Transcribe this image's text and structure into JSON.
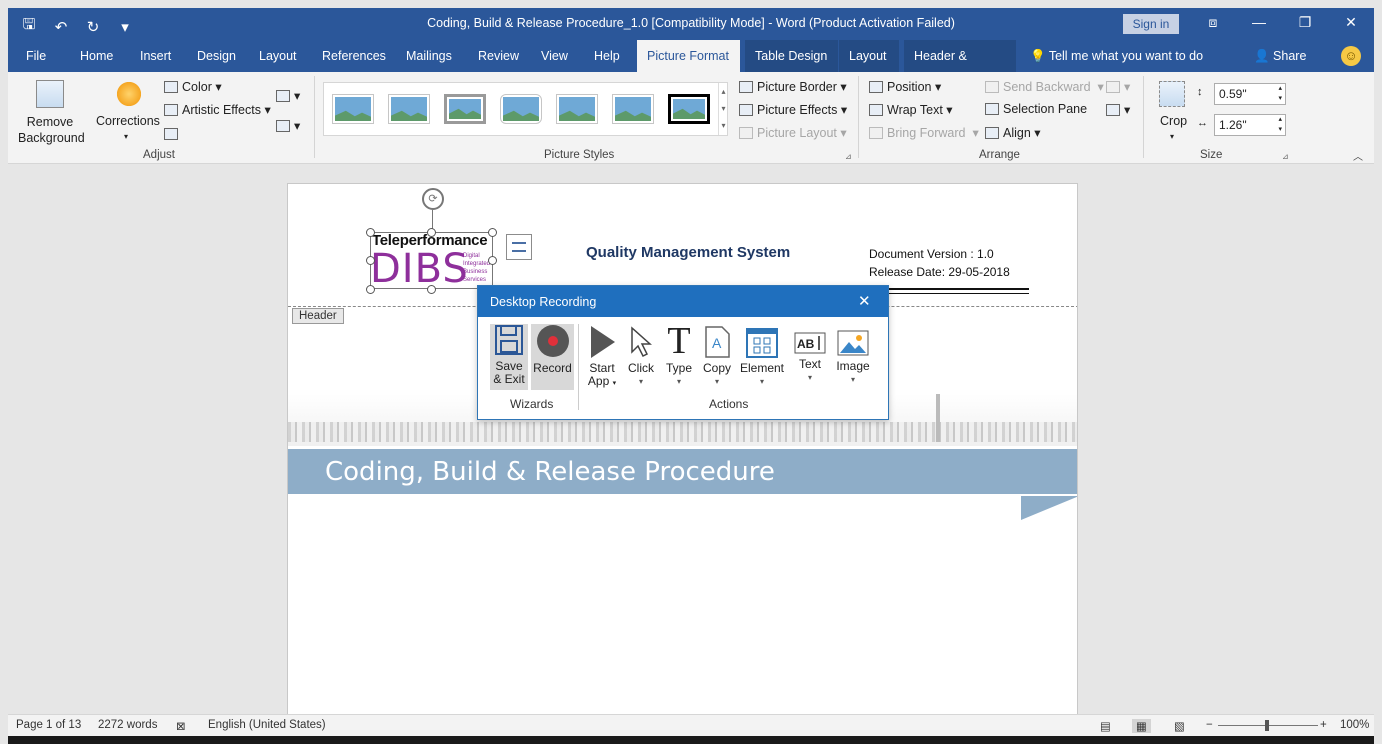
{
  "titlebar": {
    "title": "Coding, Build & Release Procedure_1.0 [Compatibility Mode]  -  Word (Product Activation Failed)",
    "sign_in": "Sign in",
    "qat": {
      "save": "🖫",
      "undo": "↶",
      "redo": "↻",
      "customize": "▾"
    },
    "window_buttons": {
      "ribbon_display": "⧈",
      "minimize": "—",
      "restore": "❐",
      "close": "✕"
    }
  },
  "tabs": [
    "File",
    "Home",
    "Insert",
    "Design",
    "Layout",
    "References",
    "Mailings",
    "Review",
    "View",
    "Help",
    "Picture Format",
    "Table Design",
    "Layout",
    "Header & Footer"
  ],
  "tell_me": "Tell me what you want to do",
  "share": "Share",
  "smiley": "☺",
  "ribbon": {
    "adjust": {
      "remove_background": "Remove Background",
      "remove_background_l1": "Remove",
      "remove_background_l2": "Background",
      "corrections": "Corrections",
      "color": "Color",
      "artistic_effects": "Artistic Effects",
      "group_label": "Adjust"
    },
    "picture_styles": {
      "picture_border": "Picture Border",
      "picture_effects": "Picture Effects",
      "picture_layout": "Picture Layout",
      "group_label": "Picture Styles"
    },
    "arrange": {
      "position": "Position",
      "wrap_text": "Wrap Text",
      "bring_forward": "Bring Forward",
      "send_backward": "Send Backward",
      "selection_pane": "Selection Pane",
      "align": "Align",
      "group_label": "Arrange"
    },
    "size": {
      "crop": "Crop",
      "height": "0.59\"",
      "width": "1.26\"",
      "group_label": "Size"
    }
  },
  "document": {
    "header_tag": "Header",
    "qms": "Quality Management System",
    "doc_version": "Document Version : 1.0",
    "release_date": "Release Date: 29-05-2018",
    "logo_brand": "Teleperformance",
    "logo_mark": "DIBS",
    "logo_sub": [
      "Digital",
      "Integrated",
      "Business",
      "Services"
    ],
    "banner_title": "Coding, Build & Release Procedure"
  },
  "recording_dialog": {
    "title": "Desktop Recording",
    "close": "✕",
    "wizards": [
      {
        "label1": "Save",
        "label2": "& Exit"
      },
      {
        "label1": "Record",
        "label2": ""
      }
    ],
    "wizards_label": "Wizards",
    "actions": [
      {
        "label1": "Start",
        "label2": "App"
      },
      {
        "label1": "Click",
        "label2": ""
      },
      {
        "label1": "Type",
        "label2": ""
      },
      {
        "label1": "Copy",
        "label2": ""
      },
      {
        "label1": "Element",
        "label2": ""
      },
      {
        "label1": "Text",
        "label2": ""
      },
      {
        "label1": "Image",
        "label2": ""
      }
    ],
    "actions_label": "Actions"
  },
  "status": {
    "page": "Page 1 of 13",
    "words": "2272 words",
    "language": "English (United States)",
    "zoom": "100%"
  },
  "colors": {
    "word_blue": "#2b579a",
    "dialog_blue": "#1f6fbe",
    "logo_purple": "#8e2f9b",
    "banner": "#8eadc8"
  }
}
